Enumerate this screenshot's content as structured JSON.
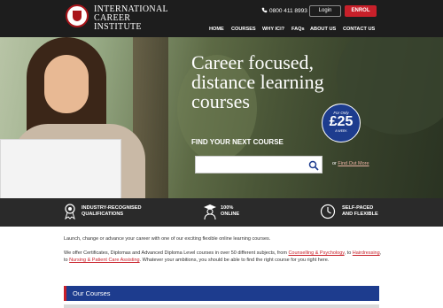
{
  "header": {
    "logo_lines": [
      "INTERNATIONAL",
      "CAREER",
      "INSTITUTE"
    ],
    "phone": "0800 411 8993",
    "login_label": "Login",
    "enrol_label": "ENROL",
    "nav": [
      "HOME",
      "COURSES",
      "WHY ICI?",
      "FAQs",
      "ABOUT US",
      "CONTACT US"
    ]
  },
  "hero": {
    "title_lines": [
      "Career focused,",
      "distance learning",
      "courses"
    ],
    "badge": {
      "line1": "For Only",
      "price": "£25",
      "line3": "A WEEK"
    },
    "find_label": "FIND YOUR NEXT COURSE",
    "search_placeholder": "",
    "or_prefix": "or",
    "find_out_more": "Find Out More"
  },
  "features": [
    {
      "icon": "certificate-icon",
      "line1": "INDUSTRY-RECOGNISED",
      "line2": "QUALIFICATIONS"
    },
    {
      "icon": "graduate-icon",
      "line1": "100%",
      "line2": "ONLINE"
    },
    {
      "icon": "clock-icon",
      "line1": "SELF-PACED",
      "line2": "AND FLEXIBLE"
    }
  ],
  "content": {
    "intro": "Launch, change or advance your career with one of our exciting flexible online learning courses.",
    "p2_a": "We offer Certificates, Diplomas and Advanced Diploma Level courses in over 50 different subjects, from ",
    "link1": "Counselling & Psychology",
    "p2_b": ", to ",
    "link2": "Hairdressing",
    "p2_c": ", to ",
    "link3": "Nursing & Patient Care Assisting",
    "p2_d": ". Whatever your ambitions, you should be able to find the right course for you right here.",
    "courses_heading": "Our Courses"
  },
  "colors": {
    "brand_red": "#c8202a",
    "brand_blue": "#1d3c8e",
    "header_bg": "#1d1d1d"
  }
}
